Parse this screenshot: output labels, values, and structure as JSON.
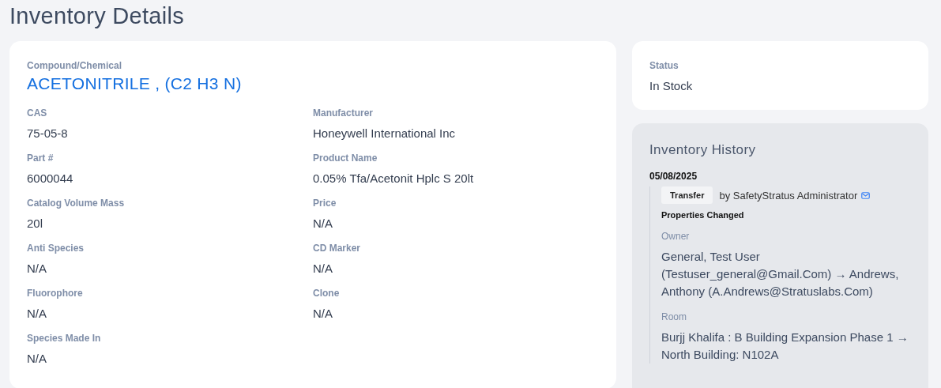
{
  "page_title": "Inventory Details",
  "compound": {
    "label": "Compound/Chemical",
    "value": "ACETONITRILE , (C2 H3 N)"
  },
  "fields": [
    {
      "label": "CAS",
      "value": "75-05-8"
    },
    {
      "label": "Manufacturer",
      "value": "Honeywell International Inc"
    },
    {
      "label": "Part #",
      "value": "6000044"
    },
    {
      "label": "Product Name",
      "value": "0.05% Tfa/Acetonit Hplc S 20lt"
    },
    {
      "label": "Catalog Volume Mass",
      "value": "20l"
    },
    {
      "label": "Price",
      "value": "N/A"
    },
    {
      "label": "Anti Species",
      "value": "N/A"
    },
    {
      "label": "CD Marker",
      "value": "N/A"
    },
    {
      "label": "Fluorophore",
      "value": "N/A"
    },
    {
      "label": "Clone",
      "value": "N/A"
    },
    {
      "label": "Species Made In",
      "value": "N/A"
    }
  ],
  "status": {
    "label": "Status",
    "value": "In Stock"
  },
  "history": {
    "title": "Inventory History",
    "entries": [
      {
        "date": "05/08/2025",
        "action": "Transfer",
        "by": "by SafetyStratus Administrator",
        "heading": "Properties Changed",
        "changes": [
          {
            "label": "Owner",
            "value": "General, Test User (Testuser_general@Gmail.Com) → Andrews, Anthony (A.Andrews@Stratuslabs.Com)"
          },
          {
            "label": "Room",
            "value": "Burjj Khalifa : B Building Expansion Phase 1 → North Building: N102A"
          }
        ]
      }
    ]
  }
}
